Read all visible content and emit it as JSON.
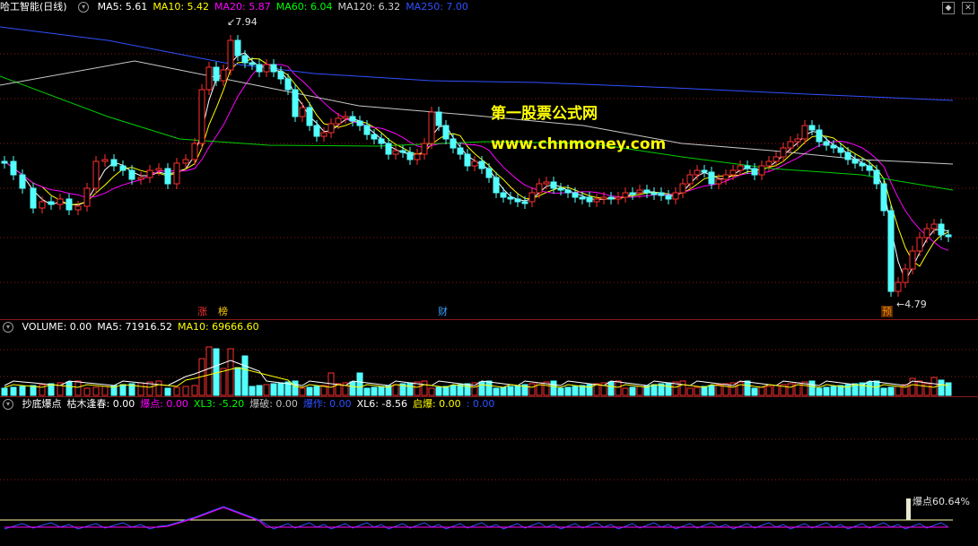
{
  "stock": {
    "name": "哈工智能",
    "period": "(日线)"
  },
  "ma_header": [
    {
      "label": "MA5: 5.61",
      "color": "#ffffff"
    },
    {
      "label": "MA10: 5.42",
      "color": "#ffff00"
    },
    {
      "label": "MA20: 5.87",
      "color": "#ff00ff"
    },
    {
      "label": "MA60: 6.04",
      "color": "#00ff00"
    },
    {
      "label": "MA120: 6.32",
      "color": "#d0d0d0"
    },
    {
      "label": "MA250: 7.00",
      "color": "#3050ff"
    }
  ],
  "price_marks": {
    "high": "7.94",
    "low": "4.79"
  },
  "watermark": {
    "line1": "第一股票公式网",
    "line2": "www.chnmoney.com"
  },
  "event_tags": [
    {
      "text": "涨",
      "color": "#ff3030"
    },
    {
      "text": "榜",
      "color": "#ffcc00"
    },
    {
      "text": "财",
      "color": "#3aa0ff"
    },
    {
      "text": "预",
      "color": "#ff8c00"
    }
  ],
  "volume_header": [
    {
      "label": "VOLUME: 0.00",
      "color": "#ffffff"
    },
    {
      "label": "MA5: 71916.52",
      "color": "#ffffff"
    },
    {
      "label": "MA10: 69666.60",
      "color": "#ffff00"
    }
  ],
  "indicator_header": [
    {
      "label": "抄底爆点",
      "color": "#ffffff"
    },
    {
      "label": "枯木逢春: 0.00",
      "color": "#ffffff"
    },
    {
      "label": "爆点: 0.00",
      "color": "#ff00ff"
    },
    {
      "label": "XL3: -5.20",
      "color": "#00ff00"
    },
    {
      "label": "爆破: 0.00",
      "color": "#c0c0c0"
    },
    {
      "label": "爆作: 0.00",
      "color": "#3050ff"
    },
    {
      "label": "XL6: -8.56",
      "color": "#ffffff"
    },
    {
      "label": "启爆: 0.00",
      "color": "#ffff00"
    },
    {
      "label": ": 0.00",
      "color": "#3050ff"
    }
  ],
  "indicator_mark": "爆点60.64%",
  "icons": {
    "minimize": "minimize-icon",
    "close": "close-icon"
  },
  "colors": {
    "up": "#ff3030",
    "down": "#54ffff",
    "grid": "#8b1a1a"
  }
}
